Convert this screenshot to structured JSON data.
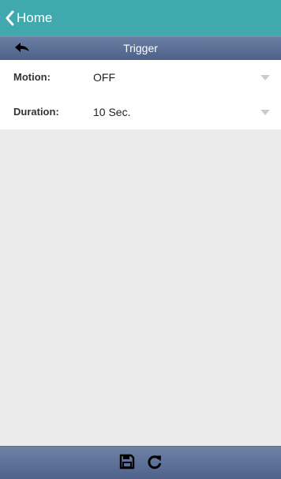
{
  "nav": {
    "back_label": "Home",
    "back_icon": "chevron-left-icon"
  },
  "subheader": {
    "title": "Trigger",
    "back_icon": "back-arrow-icon"
  },
  "form": {
    "rows": [
      {
        "label": "Motion:",
        "value": "OFF"
      },
      {
        "label": "Duration:",
        "value": "10 Sec."
      }
    ]
  },
  "toolbar": {
    "save_icon": "save-icon",
    "refresh_icon": "refresh-icon"
  },
  "colors": {
    "nav_bar": "#3fa9ad",
    "subheader_bar": "#5a6d93",
    "page_background": "#ebebeb",
    "toolbar": "#5a6d93"
  }
}
